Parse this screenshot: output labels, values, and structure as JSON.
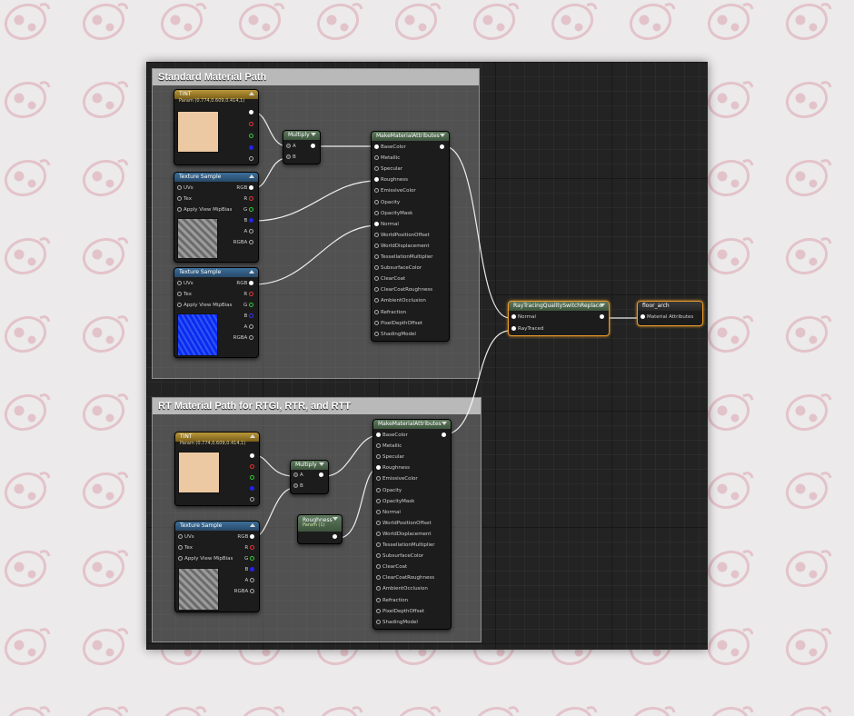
{
  "colors": {
    "tint_swatch": "#ecc9a2",
    "blue_texture": "#0a2cf0",
    "selection": "#e89a2a"
  },
  "comments": {
    "standard": "Standard Material Path",
    "rt": "RT Material Path for RTGI, RTR, and RTT"
  },
  "tint_node": {
    "title": "TINT",
    "subtitle": "Param (0.774,0.609,0.414,1)",
    "pins": [
      "",
      "",
      "",
      "",
      ""
    ]
  },
  "texture_sample": {
    "title": "Texture Sample",
    "inputs": [
      "UVs",
      "Tex",
      "Apply View MipBias"
    ],
    "outputs": [
      "RGB",
      "R",
      "G",
      "B",
      "A",
      "RGBA"
    ]
  },
  "multiply": {
    "title": "Multiply",
    "inputs": [
      "A",
      "B"
    ]
  },
  "make_material_attributes": {
    "title": "MakeMaterialAttributes",
    "inputs": [
      "BaseColor",
      "Metallic",
      "Specular",
      "Roughness",
      "EmissiveColor",
      "Opacity",
      "OpacityMask",
      "Normal",
      "WorldPositionOffset",
      "WorldDisplacement",
      "TessellationMultiplier",
      "SubsurfaceColor",
      "ClearCoat",
      "ClearCoatRoughness",
      "AmbientOcclusion",
      "Refraction",
      "PixelDepthOffset",
      "ShadingModel"
    ]
  },
  "roughness_param": {
    "title": "Roughness",
    "subtitle": "Param (1)"
  },
  "switch_node": {
    "title": "RayTracingQualitySwitchReplace",
    "inputs": [
      "Normal",
      "RayTraced"
    ]
  },
  "output_node": {
    "title": "floor_arch",
    "input": "Material Attributes"
  }
}
